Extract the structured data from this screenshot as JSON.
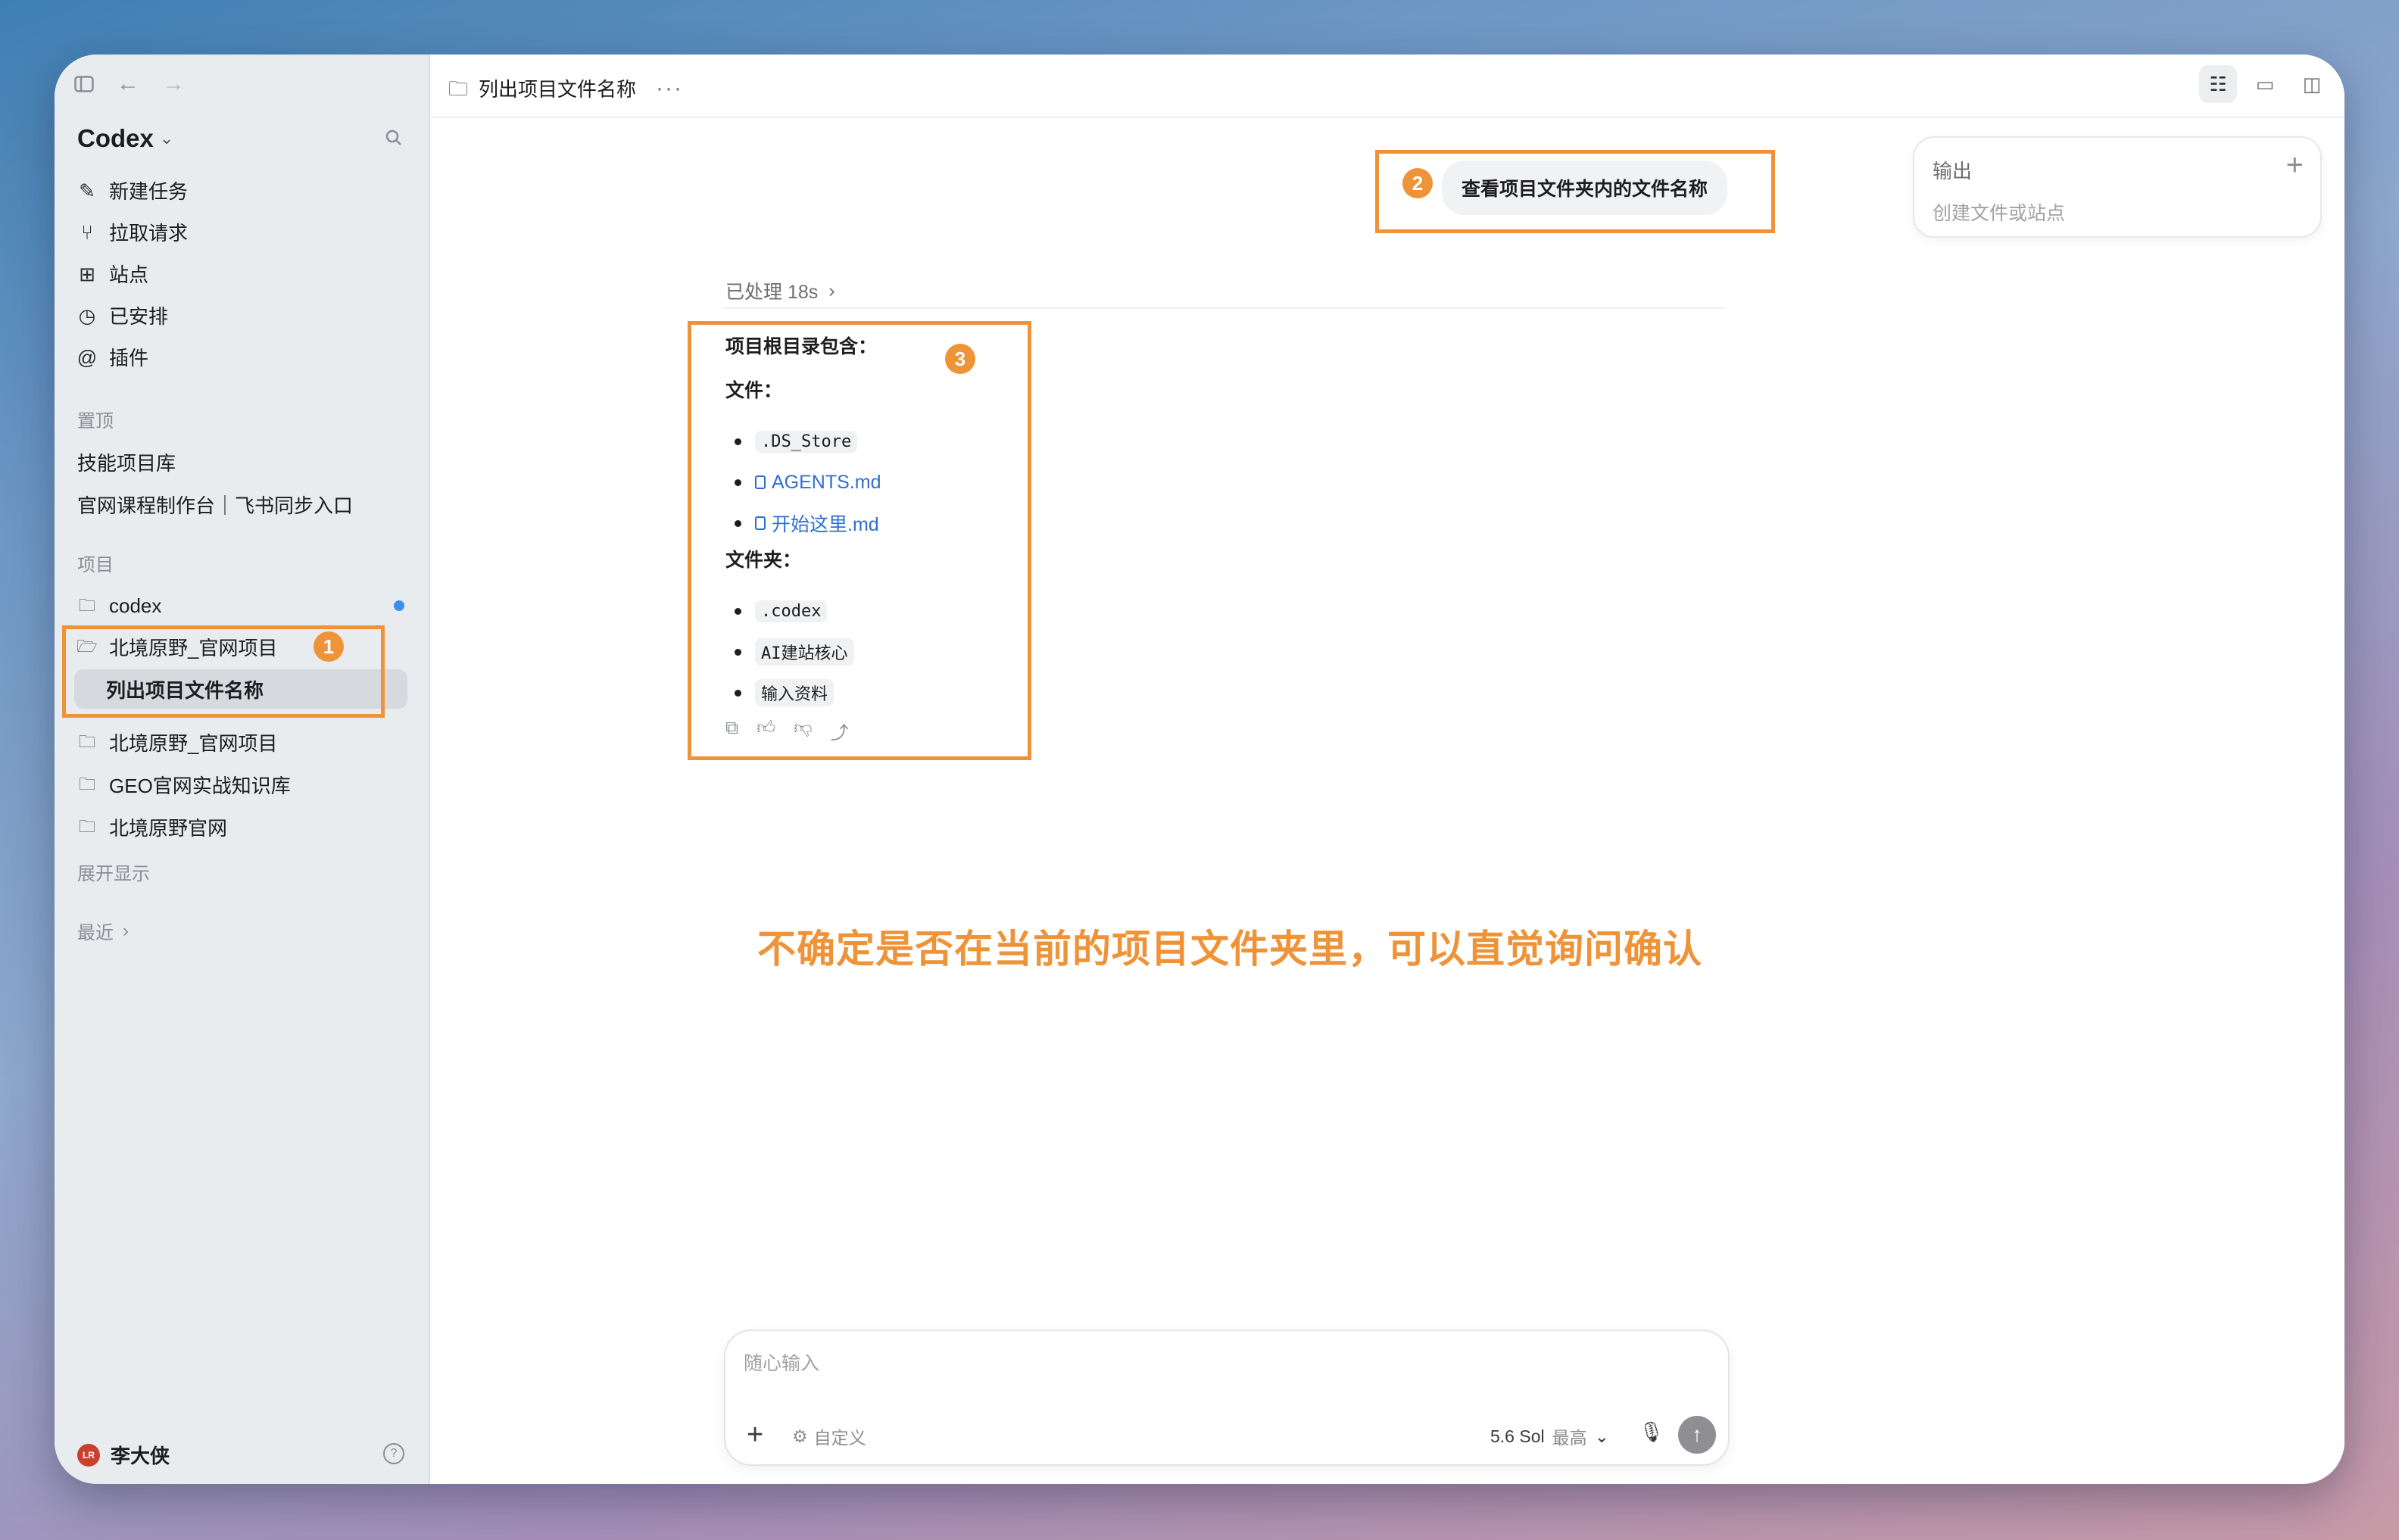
{
  "app": {
    "title": "Codex"
  },
  "sidebar": {
    "nav": [
      {
        "label": "新建任务",
        "icon": "edit-icon"
      },
      {
        "label": "拉取请求",
        "icon": "pull-request-icon"
      },
      {
        "label": "站点",
        "icon": "grid-icon"
      },
      {
        "label": "已安排",
        "icon": "clock-icon"
      },
      {
        "label": "插件",
        "icon": "at-icon"
      }
    ],
    "pinned_heading": "置顶",
    "pinned": [
      "技能项目库",
      "官网课程制作台｜飞书同步入口"
    ],
    "projects_heading": "项目",
    "projects": [
      {
        "label": "codex"
      },
      {
        "label": "北境原野_官网项目",
        "child": "列出项目文件名称"
      },
      {
        "label": "北境原野_官网项目"
      },
      {
        "label": "GEO官网实战知识库"
      },
      {
        "label": "北境原野官网"
      }
    ],
    "expand": "展开显示",
    "recent": "最近",
    "user": {
      "name": "李大侠",
      "initials": "LR"
    }
  },
  "topbar": {
    "title": "列出项目文件名称",
    "more": "···"
  },
  "output_panel": {
    "title": "输出",
    "subtitle": "创建文件或站点"
  },
  "chat": {
    "user_message": "查看项目文件夹内的文件名称",
    "processed": "已处理 18s",
    "answer": {
      "intro": "项目根目录包含：",
      "files_heading": "文件：",
      "files": [
        ".DS_Store",
        "AGENTS.md",
        "开始这里.md"
      ],
      "folders_heading": "文件夹：",
      "folders": [
        ".codex",
        "AI建站核心",
        "输入资料"
      ]
    }
  },
  "annotations": {
    "badges": [
      "1",
      "2",
      "3"
    ],
    "note": "不确定是否在当前的项目文件夹里，可以直觉询问确认",
    "color": "#ee9338"
  },
  "composer": {
    "placeholder": "随心输入",
    "custom": "自定义",
    "model": "5.6 Sol",
    "level": "最高"
  }
}
